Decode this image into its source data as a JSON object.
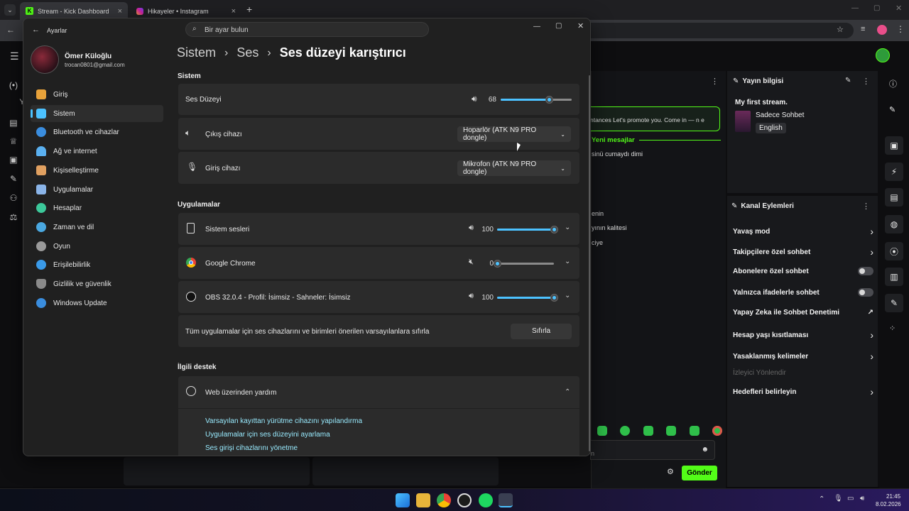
{
  "browser": {
    "tabs": [
      {
        "title": "Stream - Kick Dashboard"
      },
      {
        "title": "Hikayeler • Instagram"
      }
    ],
    "new_tab": "+"
  },
  "kick": {
    "chat": {
      "lines": [
        "ntances Let's promote you. Come in — n e",
        "Yeni mesajlar",
        "sinü cumaydı dimi",
        "enin",
        "yının kalitesi",
        "ciye"
      ],
      "input_placeholder": "n",
      "send_label": "Gönder"
    },
    "stream_info": {
      "header": "Yayın bilgisi",
      "title": "My first stream.",
      "category": "Sadece Sohbet",
      "language": "English"
    },
    "channel_actions": {
      "header": "Kanal Eylemleri",
      "items": [
        {
          "label": "Yavaş mod",
          "control": "chevron"
        },
        {
          "label": "Takipçilere özel sohbet",
          "control": "chevron"
        },
        {
          "label": "Abonelere özel sohbet",
          "control": "toggle"
        },
        {
          "label": "Yalnızca ifadelerle sohbet",
          "control": "toggle"
        },
        {
          "label": "Yapay Zeka ile Sohbet Denetimi",
          "control": "external"
        },
        {
          "label": "Hesap yaşı kısıtlaması",
          "control": "chevron"
        },
        {
          "label": "Yasaklanmış kelimeler",
          "control": "chevron"
        },
        {
          "label": "İzleyici Yönlendir",
          "control": "disabled"
        },
        {
          "label": "Hedefleri belirleyin",
          "control": "chevron"
        }
      ]
    },
    "rail_label": "Y"
  },
  "settings": {
    "window_title": "Ayarlar",
    "search_placeholder": "Bir ayar bulun",
    "user": {
      "name": "Ömer Küloğlu",
      "email": "trocan0801@gmail.com"
    },
    "nav": [
      {
        "label": "Giriş",
        "icon": "home-icon",
        "color": "#e8a23a"
      },
      {
        "label": "Sistem",
        "icon": "system-icon",
        "color": "#4cc2ff",
        "selected": true
      },
      {
        "label": "Bluetooth ve cihazlar",
        "icon": "bluetooth-icon",
        "color": "#3a8dde"
      },
      {
        "label": "Ağ ve internet",
        "icon": "wifi-icon",
        "color": "#5ab0f0"
      },
      {
        "label": "Kişiselleştirme",
        "icon": "brush-icon",
        "color": "#e0a060"
      },
      {
        "label": "Uygulamalar",
        "icon": "apps-icon",
        "color": "#8ab4e8"
      },
      {
        "label": "Hesaplar",
        "icon": "account-icon",
        "color": "#3cc89a"
      },
      {
        "label": "Zaman ve dil",
        "icon": "globe-clock-icon",
        "color": "#4aa8e0"
      },
      {
        "label": "Oyun",
        "icon": "gamepad-icon",
        "color": "#9a9a9a"
      },
      {
        "label": "Erişilebilirlik",
        "icon": "accessibility-icon",
        "color": "#3a9ae8"
      },
      {
        "label": "Gizlilik ve güvenlik",
        "icon": "shield-icon",
        "color": "#8a8a8a"
      },
      {
        "label": "Windows Update",
        "icon": "update-icon",
        "color": "#3a8dde"
      }
    ],
    "breadcrumb": {
      "level1": "Sistem",
      "level2": "Ses",
      "current": "Ses düzeyi karıştırıcı",
      "sep": "›"
    },
    "system_section": "Sistem",
    "master_volume": {
      "label": "Ses Düzeyi",
      "value": 68
    },
    "output": {
      "label": "Çıkış cihazı",
      "value": "Hoparlör (ATK N9 PRO dongle)"
    },
    "input": {
      "label": "Giriş cihazı",
      "value": "Mikrofon (ATK N9 PRO dongle)"
    },
    "apps_section": "Uygulamalar",
    "apps": [
      {
        "name": "Sistem sesleri",
        "volume": 100,
        "muted": false
      },
      {
        "name": "Google Chrome",
        "volume": 0,
        "muted": true
      },
      {
        "name": "OBS 32.0.4 - Profil: İsimsiz - Sahneler: İsimsiz",
        "volume": 100,
        "muted": false
      }
    ],
    "reset": {
      "text": "Tüm uygulamalar için ses cihazlarını ve birimleri önerilen varsayılanlara sıfırla",
      "button": "Sıfırla"
    },
    "support_section": "İlgili destek",
    "web_help": "Web üzerinden yardım",
    "links": [
      "Varsayılan kayıttan yürütme cihazını yapılandırma",
      "Uygulamalar için ses düzeyini ayarlama",
      "Ses girişi cihazlarını yönetme"
    ]
  },
  "taskbar": {
    "time": "21:45",
    "date": "8.02.2026"
  },
  "colors": {
    "accent": "#4cc2ff",
    "kick_green": "#53fc18",
    "link": "#99ebff"
  }
}
